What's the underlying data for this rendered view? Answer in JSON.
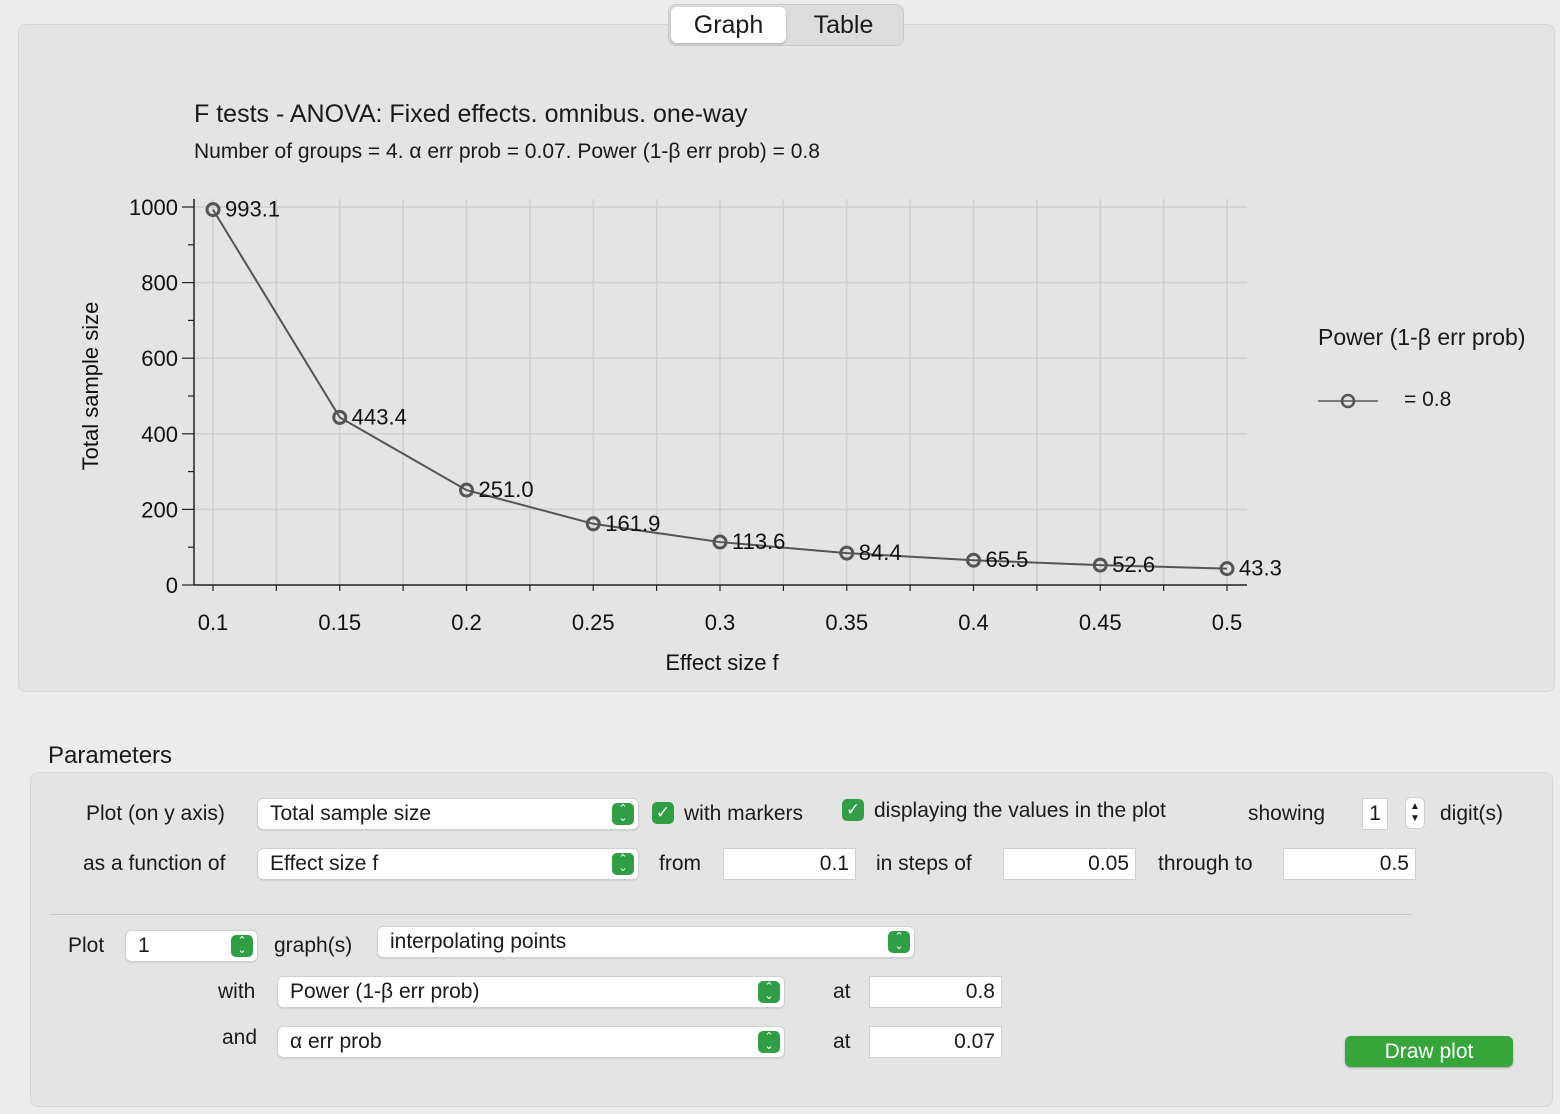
{
  "tabs": [
    {
      "label": "Graph",
      "active": true
    },
    {
      "label": "Table",
      "active": false
    }
  ],
  "chart_data": {
    "type": "line",
    "title": "F tests - ANOVA: Fixed effects. omnibus. one-way",
    "subtitle": "Number of groups = 4. α err prob = 0.07. Power (1-β err prob) = 0.8",
    "xlabel": "Effect size f",
    "ylabel": "Total sample size",
    "x": [
      0.1,
      0.15,
      0.2,
      0.25,
      0.3,
      0.35,
      0.4,
      0.45,
      0.5
    ],
    "x_tick_labels": [
      "0.1",
      "0.15",
      "0.2",
      "0.25",
      "0.3",
      "0.35",
      "0.4",
      "0.45",
      "0.5"
    ],
    "y_ticks": [
      0,
      200,
      400,
      600,
      800,
      1000
    ],
    "y_tick_labels": [
      "0",
      "200",
      "400",
      "600",
      "800",
      "1000"
    ],
    "xlim": [
      0.1,
      0.5
    ],
    "ylim": [
      0,
      1000
    ],
    "grid": true,
    "series": [
      {
        "name": "= 0.8",
        "values": [
          993.1,
          443.4,
          251.0,
          161.9,
          113.6,
          84.4,
          65.5,
          52.6,
          43.3
        ],
        "labels": [
          "993.1",
          "443.4",
          "251.0",
          "161.9",
          "113.6",
          "84.4",
          "65.5",
          "52.6",
          "43.3"
        ],
        "color": "#555555"
      }
    ],
    "legend_title": "Power (1-β err prob)",
    "legend_position": "right"
  },
  "params": {
    "title": "Parameters",
    "plot_y_label": "Plot (on y axis)",
    "plot_y_value": "Total sample size",
    "with_markers_label": "with markers",
    "with_markers_checked": true,
    "display_values_label": "displaying the values in the plot",
    "display_values_checked": true,
    "showing_label": "showing",
    "digits_value": "1",
    "digits_label": "digit(s)",
    "function_label": "as a function of",
    "function_value": "Effect size f",
    "from_label": "from",
    "from_value": "0.1",
    "steps_label": "in steps of",
    "steps_value": "0.05",
    "through_label": "through to",
    "through_value": "0.5",
    "plot_label": "Plot",
    "plot_count": "1",
    "graphs_label": "graph(s)",
    "interp_value": "interpolating points",
    "with_label": "with",
    "with_value": "Power (1-β err prob)",
    "at_label": "at",
    "with_at_value": "0.8",
    "and_label": "and",
    "and_value": "α err prob",
    "and_at_value": "0.07",
    "draw_button": "Draw plot"
  },
  "colors": {
    "accent": "#36a63a",
    "line": "#555555"
  },
  "icons": [
    "checkmark-icon",
    "updown-chevron-icon",
    "stepper-icon"
  ]
}
